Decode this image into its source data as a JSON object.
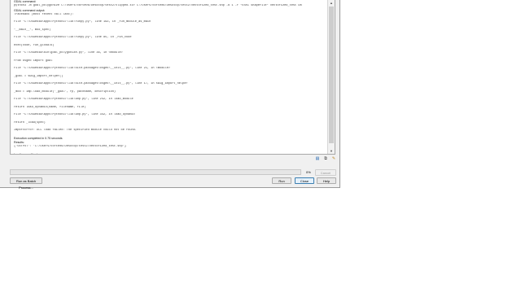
{
  "log": {
    "lines": [
      {
        "text": "GDAL command:",
        "style": "sans"
      },
      {
        "text": "python3 -m gdal_polygonize C:/Users/corte06/Desktop/test2/clipped.tif C:/Users/corte06/Desktop/test2/vectorized_test.shp -b 1 -f \"ESRI Shapefile\" vectorized_test DN",
        "style": "mono"
      },
      {
        "text": "GDAL command output:",
        "style": "sans"
      },
      {
        "text": "Traceback (most recent call last):",
        "style": "mono"
      },
      {
        "text": "",
        "style": "gap"
      },
      {
        "text": "File \"C:\\OSGeo4W\\apps\\Python37\\lib\\runpy.py\", line 193, in _run_module_as_main",
        "style": "mono"
      },
      {
        "text": "",
        "style": "gap"
      },
      {
        "text": "\"__main__\", mod_spec)",
        "style": "mono"
      },
      {
        "text": "",
        "style": "gap"
      },
      {
        "text": "File \"C:\\OSGeo4W\\apps\\Python37\\lib\\runpy.py\", line 85, in _run_code",
        "style": "mono"
      },
      {
        "text": "",
        "style": "gap"
      },
      {
        "text": "exec(code, run_globals)",
        "style": "mono"
      },
      {
        "text": "",
        "style": "gap"
      },
      {
        "text": "File \"C:\\OSGeo4W\\bin\\gdal_polygonize.py\", line 36, in <module>",
        "style": "mono"
      },
      {
        "text": "",
        "style": "gap"
      },
      {
        "text": "from osgeo import gdal",
        "style": "mono"
      },
      {
        "text": "",
        "style": "gap"
      },
      {
        "text": "File \"C:\\OSGeo4W\\apps\\Python37\\lib\\site-packages\\osgeo\\__init__.py\", line 21, in <module>",
        "style": "mono"
      },
      {
        "text": "",
        "style": "gap"
      },
      {
        "text": "_gdal = swig_import_helper()",
        "style": "mono"
      },
      {
        "text": "",
        "style": "gap"
      },
      {
        "text": "File \"C:\\OSGeo4W\\apps\\Python37\\lib\\site-packages\\osgeo\\__init__.py\", line 17, in swig_import_helper",
        "style": "mono"
      },
      {
        "text": "",
        "style": "gap"
      },
      {
        "text": "_mod = imp.load_module('_gdal', fp, pathname, description)",
        "style": "mono"
      },
      {
        "text": "",
        "style": "gap"
      },
      {
        "text": "File \"C:\\OSGeo4W\\apps\\Python37\\lib\\imp.py\", line 242, in load_module",
        "style": "mono"
      },
      {
        "text": "",
        "style": "gap"
      },
      {
        "text": "return load_dynamic(name, filename, file)",
        "style": "mono"
      },
      {
        "text": "",
        "style": "gap"
      },
      {
        "text": "File \"C:\\OSGeo4W\\apps\\Python37\\lib\\imp.py\", line 342, in load_dynamic",
        "style": "mono"
      },
      {
        "text": "",
        "style": "gap"
      },
      {
        "text": "return _load(spec)",
        "style": "mono"
      },
      {
        "text": "",
        "style": "gap"
      },
      {
        "text": "ImportError: DLL load failed: The specified module could not be found.",
        "style": "mono"
      },
      {
        "text": "",
        "style": "gap"
      },
      {
        "text": "Execution completed in 0.75 seconds",
        "style": "sans"
      },
      {
        "text": "Results:",
        "style": "sans"
      },
      {
        "text": "{'OUTPUT': 'C:/Users/corte06/Desktop/test2/vectorized_test.shp'}",
        "style": "mono"
      },
      {
        "text": "",
        "style": "gap"
      },
      {
        "text": "Loading resulting layers",
        "style": "sans"
      },
      {
        "text": "The following layers were not correctly generated.<ul><li>C:/Users/corte06/Desktop/test2/vectorized_test.shp</li></ul>You can check the 'Log Messages Panel' in QGIS main window to find more information about the execution of the algorithm.",
        "style": "warn"
      }
    ]
  },
  "toolbar": {
    "icons": [
      {
        "name": "save-log-icon",
        "glyph": "▤",
        "color": "#2a6bb3"
      },
      {
        "name": "copy-log-icon",
        "glyph": "⧉",
        "color": "#555555"
      },
      {
        "name": "clear-log-icon",
        "glyph": "✎",
        "color": "#c08a2a"
      }
    ]
  },
  "progress": {
    "value": 0,
    "label": "0%",
    "fill_color": "#3fa34d"
  },
  "buttons": {
    "cancel": "Cancel",
    "batch": "Run as Batch Process...",
    "run": "Run",
    "close": "Close",
    "help": "Help"
  }
}
